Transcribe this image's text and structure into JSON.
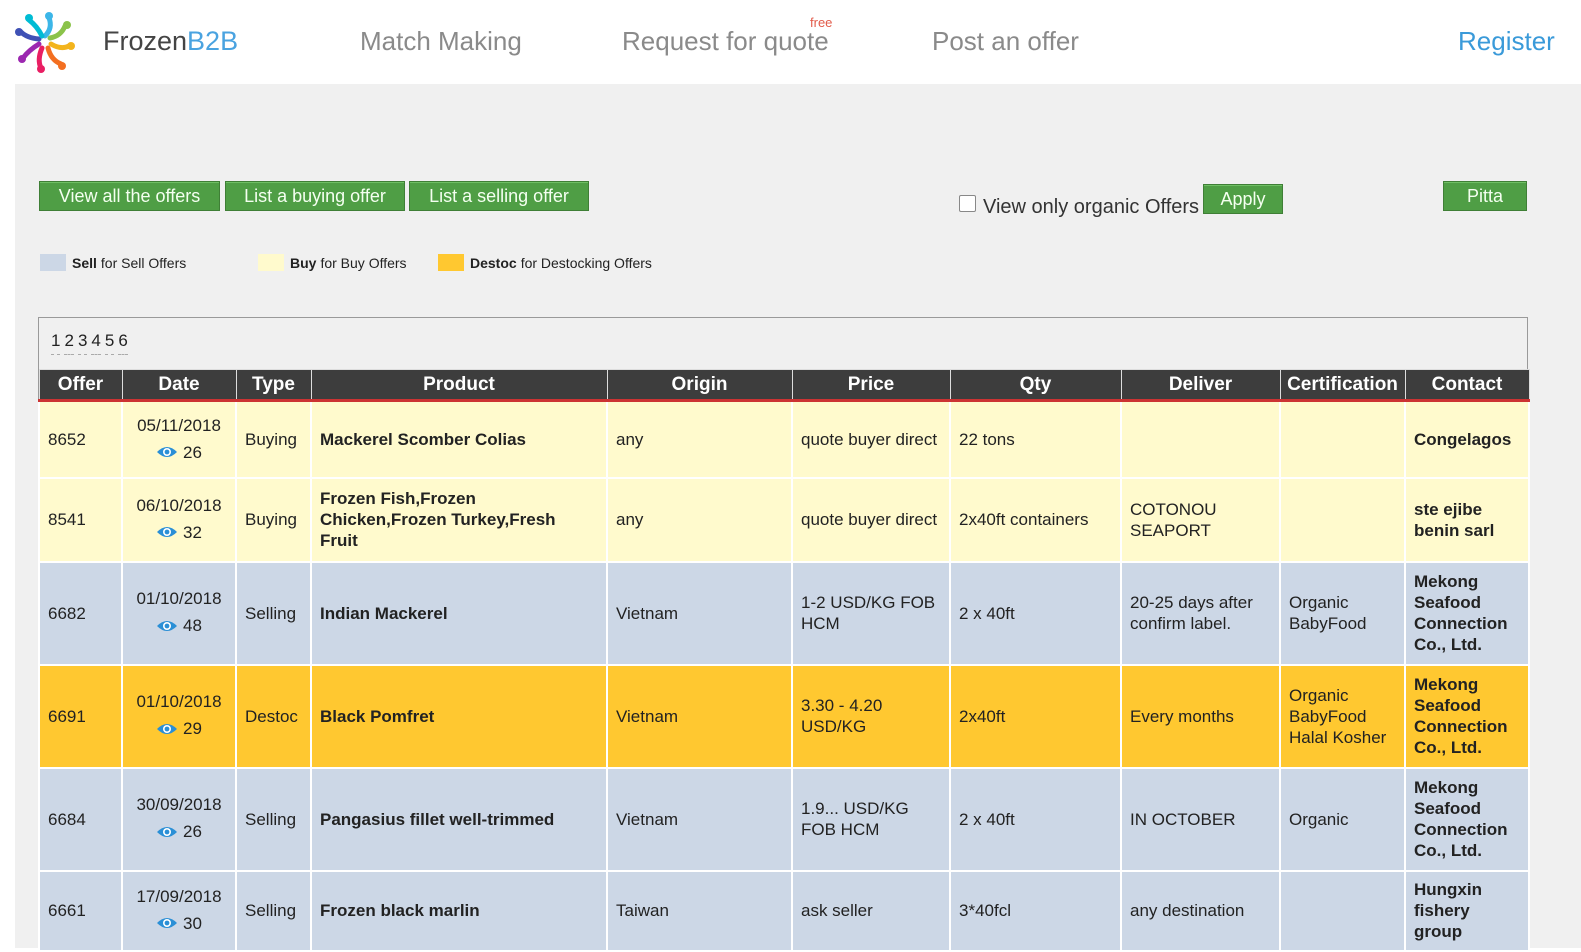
{
  "header": {
    "brand_a": "Frozen",
    "brand_b": "B2B",
    "nav_match": "Match Making",
    "nav_request": "Request for quote",
    "nav_request_badge": "free",
    "nav_post": "Post an offer",
    "register": "Register"
  },
  "toolbar": {
    "view_all": "View all the offers",
    "list_buying": "List a buying offer",
    "list_selling": "List a selling offer",
    "organic_label": "View only organic Offers",
    "organic_checked": false,
    "apply": "Apply",
    "user": "Pitta"
  },
  "legend": {
    "sell_key": "Sell",
    "sell_desc": "for Sell Offers",
    "buy_key": "Buy",
    "buy_desc": "for Buy Offers",
    "destoc_key": "Destoc",
    "destoc_desc": "for Destocking Offers",
    "colors": {
      "sell": "#ccd7e6",
      "buy": "#fffacd",
      "destoc": "#ffc830"
    }
  },
  "pagination": [
    "1",
    "2",
    "3",
    "4",
    "5",
    "6"
  ],
  "table": {
    "columns": [
      "Offer",
      "Date",
      "Type",
      "Product",
      "Origin",
      "Price",
      "Qty",
      "Deliver",
      "Certification",
      "Contact"
    ],
    "rows": [
      {
        "kind": "buy",
        "offer": "8652",
        "date": "05/11/2018",
        "views": "26",
        "type": "Buying",
        "product": "Mackerel Scomber Colias",
        "origin": "any",
        "price": "quote buyer direct",
        "qty": "22 tons",
        "deliver": "",
        "cert": "",
        "contact": "Congelagos"
      },
      {
        "kind": "buy",
        "offer": "8541",
        "date": "06/10/2018",
        "views": "32",
        "type": "Buying",
        "product": "Frozen Fish,Frozen Chicken,Frozen Turkey,Fresh Fruit",
        "origin": "any",
        "price": "quote buyer direct",
        "qty": "2x40ft containers",
        "deliver": "COTONOU SEAPORT",
        "cert": "",
        "contact": "ste ejibe benin sarl"
      },
      {
        "kind": "sell",
        "offer": "6682",
        "date": "01/10/2018",
        "views": "48",
        "type": "Selling",
        "product": "Indian Mackerel",
        "origin": "Vietnam",
        "price": "1-2 USD/KG FOB HCM",
        "qty": "2 x 40ft",
        "deliver": "20-25 days after confirm label.",
        "cert": "Organic BabyFood",
        "contact": "Mekong Seafood Connection Co., Ltd."
      },
      {
        "kind": "destoc",
        "offer": "6691",
        "date": "01/10/2018",
        "views": "29",
        "type": "Destoc",
        "product": "Black Pomfret",
        "origin": "Vietnam",
        "price": "3.30 - 4.20 USD/KG",
        "qty": "2x40ft",
        "deliver": "Every months",
        "cert": "Organic BabyFood Halal Kosher",
        "contact": "Mekong Seafood Connection Co., Ltd."
      },
      {
        "kind": "sell",
        "offer": "6684",
        "date": "30/09/2018",
        "views": "26",
        "type": "Selling",
        "product": "Pangasius fillet well-trimmed",
        "origin": "Vietnam",
        "price": "1.9... USD/KG FOB HCM",
        "qty": "2 x 40ft",
        "deliver": "IN OCTOBER",
        "cert": "Organic",
        "contact": "Mekong Seafood Connection Co., Ltd."
      },
      {
        "kind": "sell",
        "offer": "6661",
        "date": "17/09/2018",
        "views": "30",
        "type": "Selling",
        "product": "Frozen black marlin",
        "origin": "Taiwan",
        "price": "ask seller",
        "qty": "3*40fcl",
        "deliver": "any destination",
        "cert": "",
        "contact": "Hungxin fishery group"
      }
    ]
  }
}
